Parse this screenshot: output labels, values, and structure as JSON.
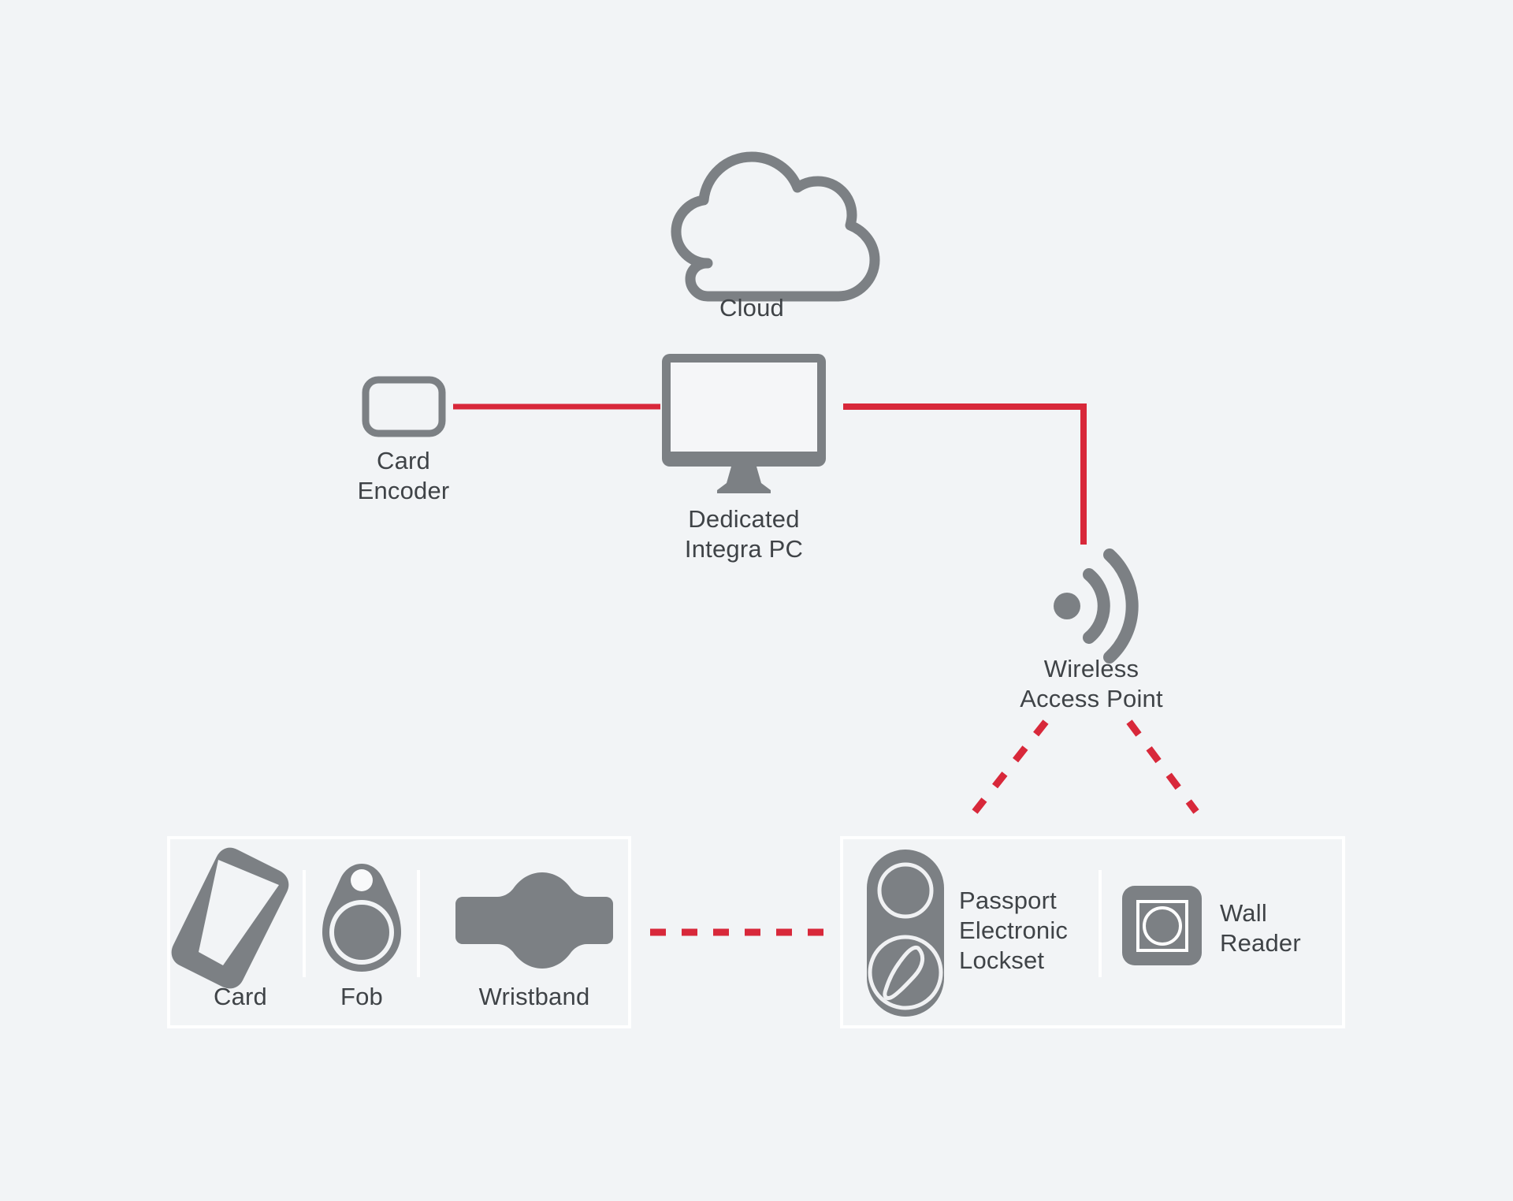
{
  "diagram": {
    "title": "Access Control System Topology",
    "background_color": "#f2f4f6",
    "icon_gray": "#7c8084",
    "line_red": "#d8283a",
    "text_color": "#3f4347",
    "panel_border_color": "#ffffff"
  },
  "nodes": {
    "cloud": {
      "label": "Cloud",
      "icon": "cloud-icon"
    },
    "card_encoder": {
      "label": "Card\nEncoder",
      "icon": "card-encoder-icon"
    },
    "pc": {
      "label": "Dedicated\nIntegra PC",
      "icon": "desktop-monitor-icon"
    },
    "access_point": {
      "label": "Wireless\nAccess Point",
      "icon": "wireless-signal-icon"
    }
  },
  "credentials_panel": {
    "items": [
      {
        "label": "Card",
        "icon": "access-card-icon"
      },
      {
        "label": "Fob",
        "icon": "key-fob-icon"
      },
      {
        "label": "Wristband",
        "icon": "wristband-icon"
      }
    ]
  },
  "locks_panel": {
    "items": [
      {
        "label": "Passport\nElectronic\nLockset",
        "icon": "electronic-lockset-icon"
      },
      {
        "label": "Wall\nReader",
        "icon": "wall-reader-icon"
      }
    ]
  },
  "connections": [
    {
      "name": "encoder-to-pc",
      "style": "solid",
      "color": "#d8283a"
    },
    {
      "name": "pc-to-access-point",
      "style": "solid",
      "color": "#d8283a"
    },
    {
      "name": "access-point-to-lockset",
      "style": "dashed",
      "color": "#d8283a"
    },
    {
      "name": "access-point-to-wall-reader",
      "style": "dashed",
      "color": "#d8283a"
    },
    {
      "name": "credentials-to-locks",
      "style": "dashed",
      "color": "#d8283a"
    }
  ]
}
